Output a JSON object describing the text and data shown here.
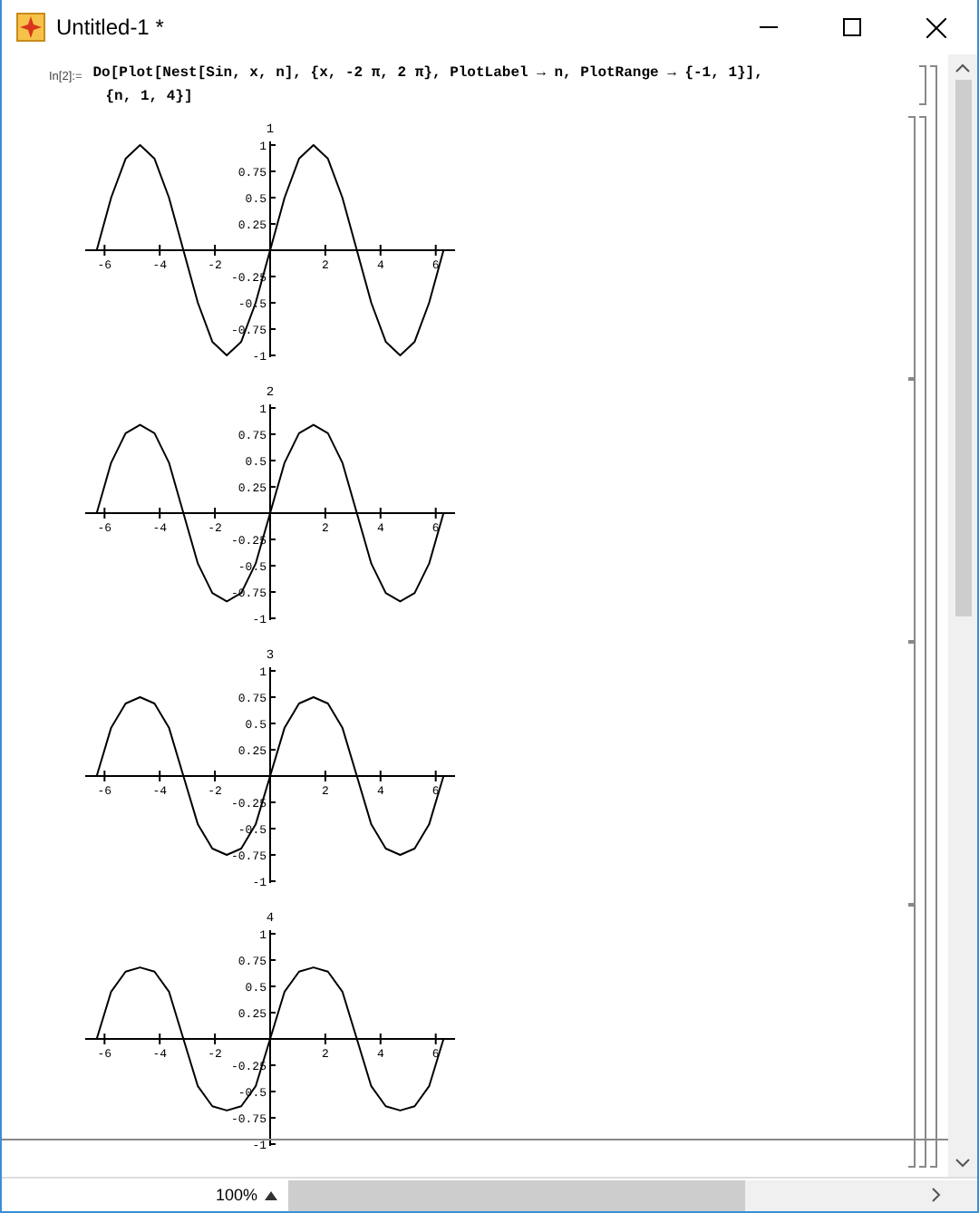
{
  "window": {
    "title": "Untitled-1 *"
  },
  "input_cell": {
    "label": "In[2]:=",
    "lines": [
      "Do[Plot[Nest[Sin, x, n], {x, -2 π, 2 π}, PlotLabel → n, PlotRange → {-1, 1}],",
      "{n, 1, 4}]"
    ]
  },
  "outputs": [
    {
      "chart_data": {
        "type": "line",
        "title": "1",
        "x": [
          -6.283,
          -5.76,
          -5.236,
          -4.712,
          -4.189,
          -3.665,
          -3.142,
          -2.618,
          -2.094,
          -1.571,
          -1.047,
          -0.524,
          0,
          0.524,
          1.047,
          1.571,
          2.094,
          2.618,
          3.142,
          3.665,
          4.189,
          4.712,
          5.236,
          5.76,
          6.283
        ],
        "series": [
          {
            "color": "#000000",
            "values": [
              0,
              0.5,
              0.87,
              1,
              0.87,
              0.5,
              0,
              -0.5,
              -0.87,
              -1,
              -0.87,
              -0.5,
              0,
              0.5,
              0.87,
              1,
              0.87,
              0.5,
              0,
              -0.5,
              -0.87,
              -1,
              -0.87,
              -0.5,
              0
            ]
          }
        ],
        "xlim": [
          -6.7,
          6.7
        ],
        "ylim": [
          -1,
          1
        ],
        "xticks": [
          -6,
          -4,
          -2,
          2,
          4,
          6
        ],
        "yticks": [
          1,
          0.75,
          0.5,
          0.25,
          -0.25,
          -0.5,
          -0.75,
          -1
        ]
      }
    },
    {
      "chart_data": {
        "type": "line",
        "title": "2",
        "x": [
          -6.283,
          -5.76,
          -5.236,
          -4.712,
          -4.189,
          -3.665,
          -3.142,
          -2.618,
          -2.094,
          -1.571,
          -1.047,
          -0.524,
          0,
          0.524,
          1.047,
          1.571,
          2.094,
          2.618,
          3.142,
          3.665,
          4.189,
          4.712,
          5.236,
          5.76,
          6.283
        ],
        "series": [
          {
            "color": "#000000",
            "values": [
              0,
              0.48,
              0.76,
              0.84,
              0.76,
              0.48,
              0,
              -0.48,
              -0.76,
              -0.84,
              -0.76,
              -0.48,
              0,
              0.48,
              0.76,
              0.84,
              0.76,
              0.48,
              0,
              -0.48,
              -0.76,
              -0.84,
              -0.76,
              -0.48,
              0
            ]
          }
        ],
        "xlim": [
          -6.7,
          6.7
        ],
        "ylim": [
          -1,
          1
        ],
        "xticks": [
          -6,
          -4,
          -2,
          2,
          4,
          6
        ],
        "yticks": [
          1,
          0.75,
          0.5,
          0.25,
          -0.25,
          -0.5,
          -0.75,
          -1
        ]
      }
    },
    {
      "chart_data": {
        "type": "line",
        "title": "3",
        "x": [
          -6.283,
          -5.76,
          -5.236,
          -4.712,
          -4.189,
          -3.665,
          -3.142,
          -2.618,
          -2.094,
          -1.571,
          -1.047,
          -0.524,
          0,
          0.524,
          1.047,
          1.571,
          2.094,
          2.618,
          3.142,
          3.665,
          4.189,
          4.712,
          5.236,
          5.76,
          6.283
        ],
        "series": [
          {
            "color": "#000000",
            "values": [
              0,
              0.46,
              0.69,
              0.75,
              0.69,
              0.46,
              0,
              -0.46,
              -0.69,
              -0.75,
              -0.69,
              -0.46,
              0,
              0.46,
              0.69,
              0.75,
              0.69,
              0.46,
              0,
              -0.46,
              -0.69,
              -0.75,
              -0.69,
              -0.46,
              0
            ]
          }
        ],
        "xlim": [
          -6.7,
          6.7
        ],
        "ylim": [
          -1,
          1
        ],
        "xticks": [
          -6,
          -4,
          -2,
          2,
          4,
          6
        ],
        "yticks": [
          1,
          0.75,
          0.5,
          0.25,
          -0.25,
          -0.5,
          -0.75,
          -1
        ]
      }
    },
    {
      "chart_data": {
        "type": "line",
        "title": "4",
        "x": [
          -6.283,
          -5.76,
          -5.236,
          -4.712,
          -4.189,
          -3.665,
          -3.142,
          -2.618,
          -2.094,
          -1.571,
          -1.047,
          -0.524,
          0,
          0.524,
          1.047,
          1.571,
          2.094,
          2.618,
          3.142,
          3.665,
          4.189,
          4.712,
          5.236,
          5.76,
          6.283
        ],
        "series": [
          {
            "color": "#000000",
            "values": [
              0,
              0.45,
              0.64,
              0.68,
              0.64,
              0.45,
              0,
              -0.45,
              -0.64,
              -0.68,
              -0.64,
              -0.45,
              0,
              0.45,
              0.64,
              0.68,
              0.64,
              0.45,
              0,
              -0.45,
              -0.64,
              -0.68,
              -0.64,
              -0.45,
              0
            ]
          }
        ],
        "xlim": [
          -6.7,
          6.7
        ],
        "ylim": [
          -1,
          1
        ],
        "xticks": [
          -6,
          -4,
          -2,
          2,
          4,
          6
        ],
        "yticks": [
          1,
          0.75,
          0.5,
          0.25,
          -0.25,
          -0.5,
          -0.75,
          -1
        ]
      }
    }
  ],
  "status_bar": {
    "zoom": "100%"
  }
}
